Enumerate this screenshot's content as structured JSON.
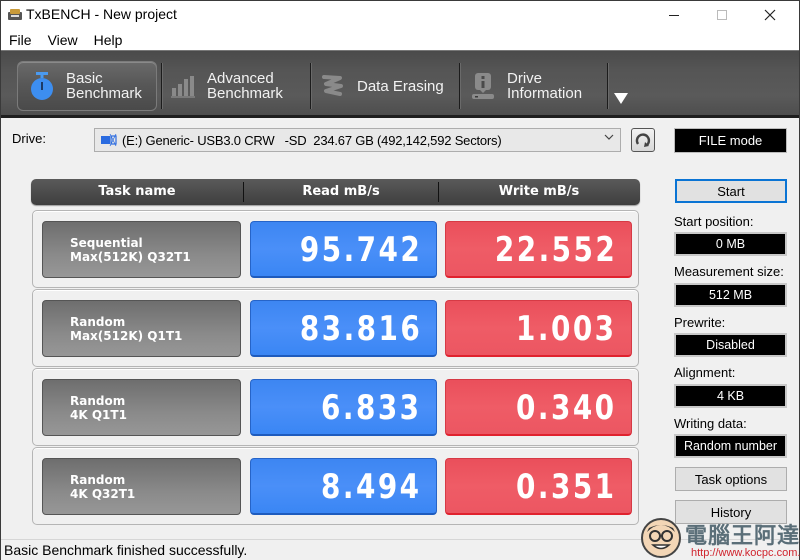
{
  "window": {
    "title": "TxBENCH - New project",
    "controls": {
      "minimize": "minimize-icon",
      "maximize": "maximize-icon",
      "close": "close-icon"
    }
  },
  "menu": [
    "File",
    "View",
    "Help"
  ],
  "toolbar": {
    "tabs": [
      {
        "line1": "Basic",
        "line2": "Benchmark",
        "icon": "stopwatch-icon",
        "active": true
      },
      {
        "line1": "Advanced",
        "line2": "Benchmark",
        "icon": "bar-chart-icon",
        "active": false
      },
      {
        "line1": "Data Erasing",
        "line2": "",
        "icon": "eraser-spring-icon",
        "active": false
      },
      {
        "line1": "Drive",
        "line2": "Information",
        "icon": "drive-info-icon",
        "active": false
      }
    ],
    "more_icon": "dropdown-triangle-icon"
  },
  "drive": {
    "label": "Drive:",
    "selected": "(E:) Generic- USB3.0 CRW   -SD  234.67 GB (492,142,592 Sectors)",
    "icon": "usb-drive-icon",
    "refresh_icon": "refresh-icon",
    "mode": "FILE mode"
  },
  "results": {
    "headers": [
      "Task name",
      "Read mB/s",
      "Write mB/s"
    ],
    "rows": [
      {
        "task_line1": "Sequential",
        "task_line2": "Max(512K) Q32T1",
        "read": "95.742",
        "write": "22.552"
      },
      {
        "task_line1": "Random",
        "task_line2": "Max(512K) Q1T1",
        "read": "83.816",
        "write": "1.003"
      },
      {
        "task_line1": "Random",
        "task_line2": "4K Q1T1",
        "read": "6.833",
        "write": "0.340"
      },
      {
        "task_line1": "Random",
        "task_line2": "4K Q32T1",
        "read": "8.494",
        "write": "0.351"
      }
    ],
    "colors": {
      "read": "#4a8ff8",
      "write": "#ef5c66",
      "task": "#858585"
    }
  },
  "panel": {
    "start_button": "Start",
    "fields": [
      {
        "label": "Start position:",
        "value": "0 MB"
      },
      {
        "label": "Measurement size:",
        "value": "512 MB"
      },
      {
        "label": "Prewrite:",
        "value": "Disabled"
      },
      {
        "label": "Alignment:",
        "value": "4 KB"
      },
      {
        "label": "Writing data:",
        "value": "Random number"
      }
    ],
    "task_options_button": "Task options",
    "history_button": "History"
  },
  "status": "Basic Benchmark finished successfully.",
  "watermark": {
    "text": "電腦王阿達",
    "url": "http://www.kocpc.com.tw"
  }
}
